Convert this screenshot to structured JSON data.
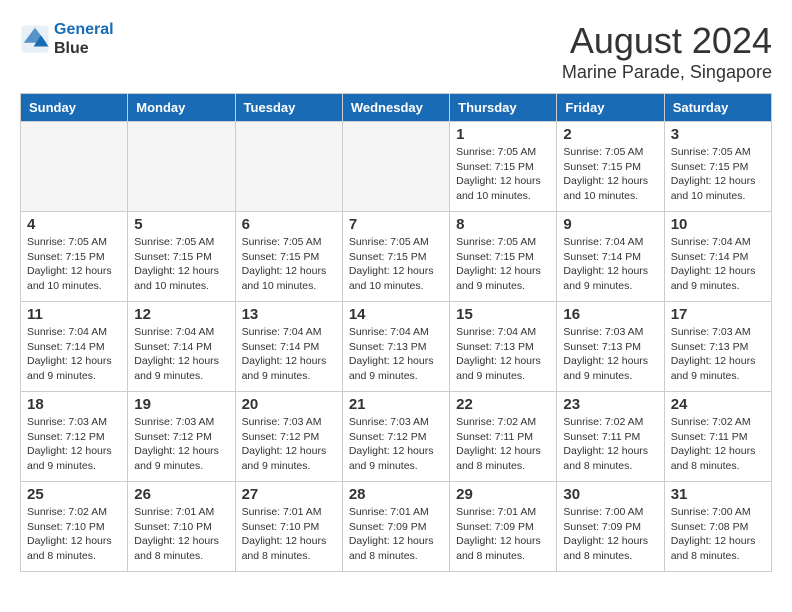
{
  "header": {
    "logo_line1": "General",
    "logo_line2": "Blue",
    "main_title": "August 2024",
    "subtitle": "Marine Parade, Singapore"
  },
  "days_of_week": [
    "Sunday",
    "Monday",
    "Tuesday",
    "Wednesday",
    "Thursday",
    "Friday",
    "Saturday"
  ],
  "weeks": [
    [
      {
        "day": "",
        "info": ""
      },
      {
        "day": "",
        "info": ""
      },
      {
        "day": "",
        "info": ""
      },
      {
        "day": "",
        "info": ""
      },
      {
        "day": "1",
        "info": "Sunrise: 7:05 AM\nSunset: 7:15 PM\nDaylight: 12 hours\nand 10 minutes."
      },
      {
        "day": "2",
        "info": "Sunrise: 7:05 AM\nSunset: 7:15 PM\nDaylight: 12 hours\nand 10 minutes."
      },
      {
        "day": "3",
        "info": "Sunrise: 7:05 AM\nSunset: 7:15 PM\nDaylight: 12 hours\nand 10 minutes."
      }
    ],
    [
      {
        "day": "4",
        "info": "Sunrise: 7:05 AM\nSunset: 7:15 PM\nDaylight: 12 hours\nand 10 minutes."
      },
      {
        "day": "5",
        "info": "Sunrise: 7:05 AM\nSunset: 7:15 PM\nDaylight: 12 hours\nand 10 minutes."
      },
      {
        "day": "6",
        "info": "Sunrise: 7:05 AM\nSunset: 7:15 PM\nDaylight: 12 hours\nand 10 minutes."
      },
      {
        "day": "7",
        "info": "Sunrise: 7:05 AM\nSunset: 7:15 PM\nDaylight: 12 hours\nand 10 minutes."
      },
      {
        "day": "8",
        "info": "Sunrise: 7:05 AM\nSunset: 7:15 PM\nDaylight: 12 hours\nand 9 minutes."
      },
      {
        "day": "9",
        "info": "Sunrise: 7:04 AM\nSunset: 7:14 PM\nDaylight: 12 hours\nand 9 minutes."
      },
      {
        "day": "10",
        "info": "Sunrise: 7:04 AM\nSunset: 7:14 PM\nDaylight: 12 hours\nand 9 minutes."
      }
    ],
    [
      {
        "day": "11",
        "info": "Sunrise: 7:04 AM\nSunset: 7:14 PM\nDaylight: 12 hours\nand 9 minutes."
      },
      {
        "day": "12",
        "info": "Sunrise: 7:04 AM\nSunset: 7:14 PM\nDaylight: 12 hours\nand 9 minutes."
      },
      {
        "day": "13",
        "info": "Sunrise: 7:04 AM\nSunset: 7:14 PM\nDaylight: 12 hours\nand 9 minutes."
      },
      {
        "day": "14",
        "info": "Sunrise: 7:04 AM\nSunset: 7:13 PM\nDaylight: 12 hours\nand 9 minutes."
      },
      {
        "day": "15",
        "info": "Sunrise: 7:04 AM\nSunset: 7:13 PM\nDaylight: 12 hours\nand 9 minutes."
      },
      {
        "day": "16",
        "info": "Sunrise: 7:03 AM\nSunset: 7:13 PM\nDaylight: 12 hours\nand 9 minutes."
      },
      {
        "day": "17",
        "info": "Sunrise: 7:03 AM\nSunset: 7:13 PM\nDaylight: 12 hours\nand 9 minutes."
      }
    ],
    [
      {
        "day": "18",
        "info": "Sunrise: 7:03 AM\nSunset: 7:12 PM\nDaylight: 12 hours\nand 9 minutes."
      },
      {
        "day": "19",
        "info": "Sunrise: 7:03 AM\nSunset: 7:12 PM\nDaylight: 12 hours\nand 9 minutes."
      },
      {
        "day": "20",
        "info": "Sunrise: 7:03 AM\nSunset: 7:12 PM\nDaylight: 12 hours\nand 9 minutes."
      },
      {
        "day": "21",
        "info": "Sunrise: 7:03 AM\nSunset: 7:12 PM\nDaylight: 12 hours\nand 9 minutes."
      },
      {
        "day": "22",
        "info": "Sunrise: 7:02 AM\nSunset: 7:11 PM\nDaylight: 12 hours\nand 8 minutes."
      },
      {
        "day": "23",
        "info": "Sunrise: 7:02 AM\nSunset: 7:11 PM\nDaylight: 12 hours\nand 8 minutes."
      },
      {
        "day": "24",
        "info": "Sunrise: 7:02 AM\nSunset: 7:11 PM\nDaylight: 12 hours\nand 8 minutes."
      }
    ],
    [
      {
        "day": "25",
        "info": "Sunrise: 7:02 AM\nSunset: 7:10 PM\nDaylight: 12 hours\nand 8 minutes."
      },
      {
        "day": "26",
        "info": "Sunrise: 7:01 AM\nSunset: 7:10 PM\nDaylight: 12 hours\nand 8 minutes."
      },
      {
        "day": "27",
        "info": "Sunrise: 7:01 AM\nSunset: 7:10 PM\nDaylight: 12 hours\nand 8 minutes."
      },
      {
        "day": "28",
        "info": "Sunrise: 7:01 AM\nSunset: 7:09 PM\nDaylight: 12 hours\nand 8 minutes."
      },
      {
        "day": "29",
        "info": "Sunrise: 7:01 AM\nSunset: 7:09 PM\nDaylight: 12 hours\nand 8 minutes."
      },
      {
        "day": "30",
        "info": "Sunrise: 7:00 AM\nSunset: 7:09 PM\nDaylight: 12 hours\nand 8 minutes."
      },
      {
        "day": "31",
        "info": "Sunrise: 7:00 AM\nSunset: 7:08 PM\nDaylight: 12 hours\nand 8 minutes."
      }
    ]
  ]
}
